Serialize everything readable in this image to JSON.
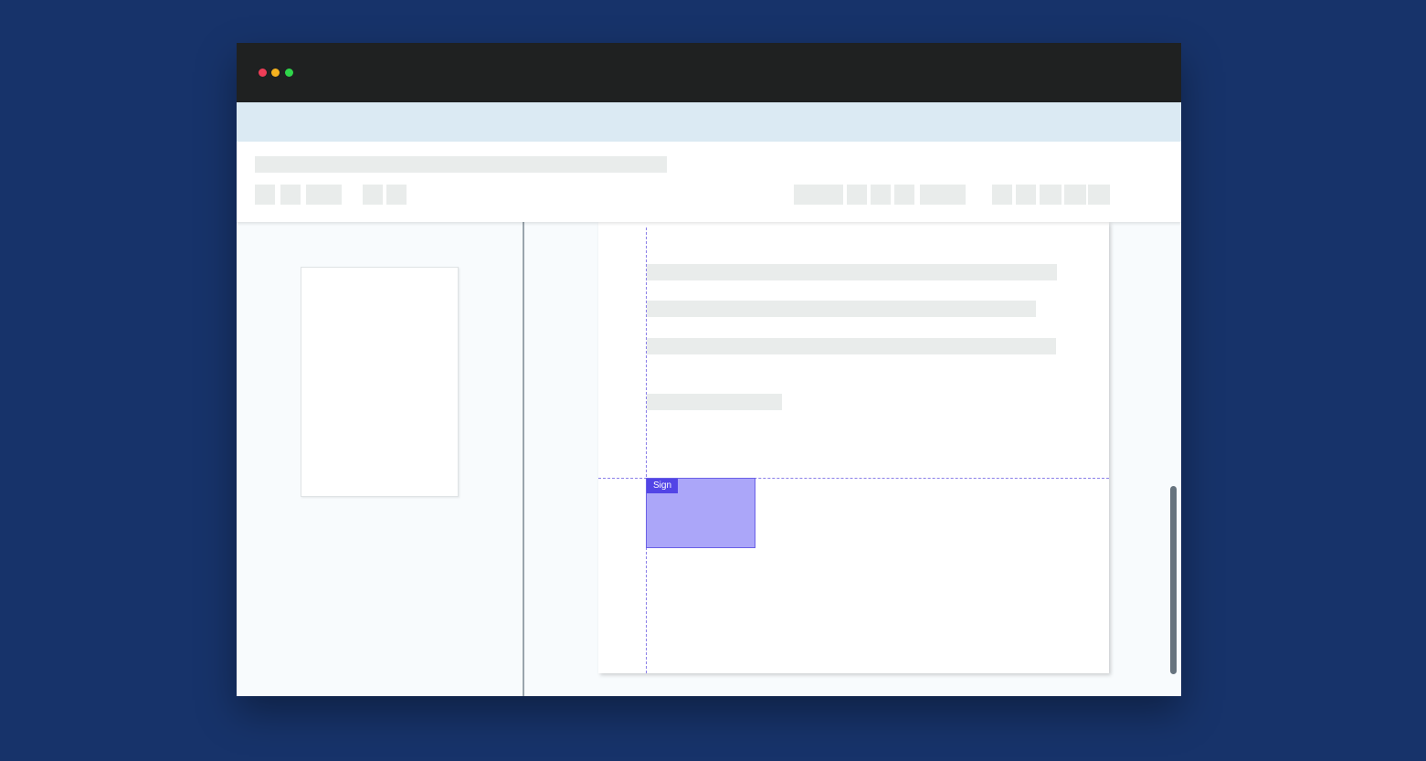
{
  "window": {
    "controls": [
      "close",
      "minimize",
      "maximize"
    ]
  },
  "document": {
    "field": {
      "label": "Sign",
      "color": "#aba6f9",
      "tag_color": "#5245e6"
    }
  },
  "colors": {
    "background": "#17336a",
    "titlebar": "#1f2121",
    "banner": "#dbeaf3",
    "placeholder": "#e9eceb",
    "guide": "#8b7fe8"
  }
}
